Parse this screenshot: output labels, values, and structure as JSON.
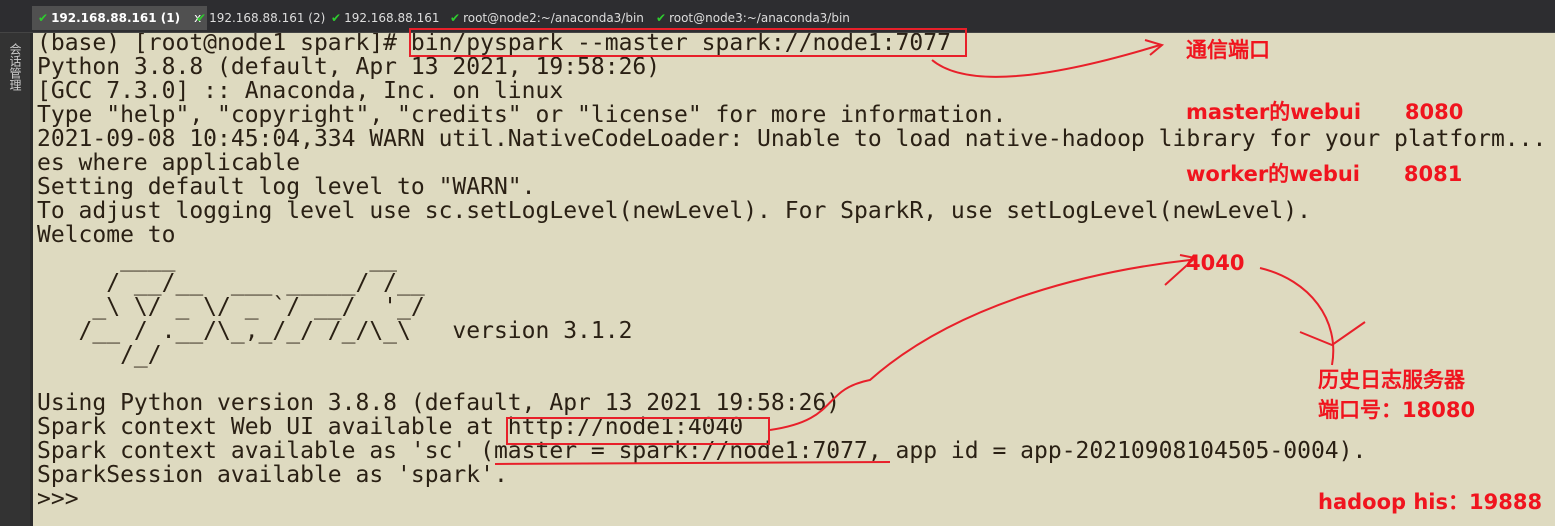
{
  "tabs": [
    {
      "label": "192.168.88.161 (1)",
      "active": true,
      "close": "x"
    },
    {
      "label": "192.168.88.161 (2)"
    },
    {
      "label": "192.168.88.161"
    },
    {
      "label": "root@node2:~/anaconda3/bin"
    },
    {
      "label": "root@node3:~/anaconda3/bin"
    }
  ],
  "sidebar_label": "会话管理",
  "terminal": {
    "lines": [
      "(base) [root@node1 spark]# bin/pyspark --master spark://node1:7077",
      "Python 3.8.8 (default, Apr 13 2021, 19:58:26)",
      "[GCC 7.3.0] :: Anaconda, Inc. on linux",
      "Type \"help\", \"copyright\", \"credits\" or \"license\" for more information.",
      "2021-09-08 10:45:04,334 WARN util.NativeCodeLoader: Unable to load native-hadoop library for your platform... using builtin-java class",
      "es where applicable",
      "Setting default log level to \"WARN\".",
      "To adjust logging level use sc.setLogLevel(newLevel). For SparkR, use setLogLevel(newLevel).",
      "Welcome to",
      "      ____              __",
      "     / __/__  ___ _____/ /__",
      "    _\\ \\/ _ \\/ _ `/ __/  '_/",
      "   /__ / .__/\\_,_/_/ /_/\\_\\   version 3.1.2",
      "      /_/",
      "",
      "Using Python version 3.8.8 (default, Apr 13 2021 19:58:26)",
      "Spark context Web UI available at http://node1:4040",
      "Spark context available as 'sc' (master = spark://node1:7077, app id = app-20210908104505-0004).",
      "SparkSession available as 'spark'.",
      ">>>"
    ]
  },
  "annotations": {
    "comm_port": "通信端口",
    "master_webui": "master的webui      8080",
    "worker_webui": "worker的webui      8081",
    "port_4040": "4040",
    "history_server": "历史日志服务器",
    "history_port": "端口号：18080",
    "hadoop_his": "hadoop his：19888"
  },
  "colors": {
    "terminal_bg": "#dedac0",
    "annotation": "#f0141e"
  }
}
